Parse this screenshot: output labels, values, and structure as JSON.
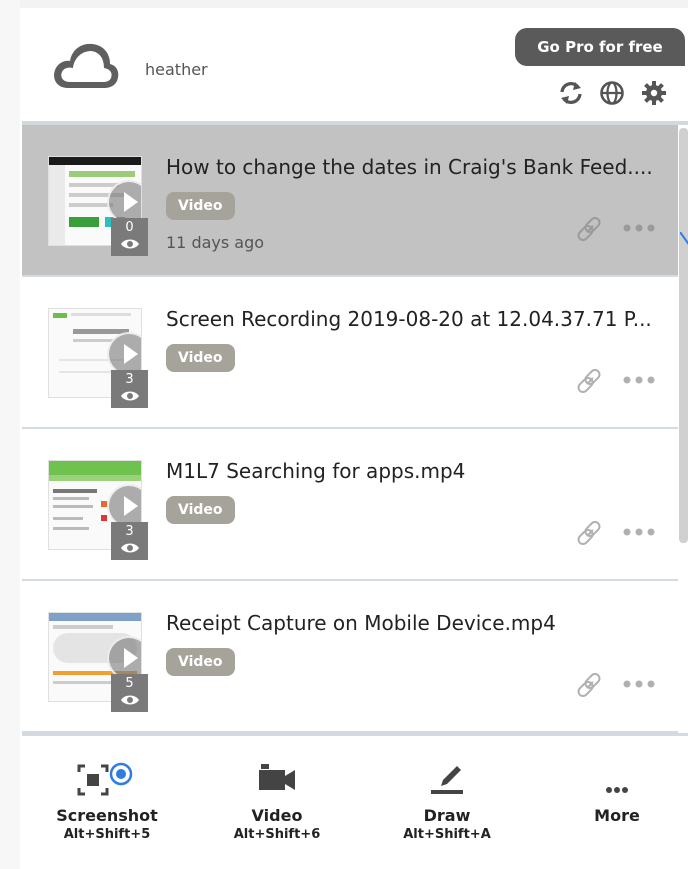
{
  "header": {
    "username": "heather",
    "gopro_label": "Go Pro for free"
  },
  "items": [
    {
      "title": "How to change the dates in Craig's Bank Feed....",
      "badge": "Video",
      "views": "0",
      "date": "11 days ago",
      "selected": true
    },
    {
      "title": "Screen Recording 2019-08-20 at 12.04.37.71 P...",
      "badge": "Video",
      "views": "3",
      "date": ""
    },
    {
      "title": "M1L7 Searching for apps.mp4",
      "badge": "Video",
      "views": "3",
      "date": ""
    },
    {
      "title": "Receipt Capture on Mobile Device.mp4",
      "badge": "Video",
      "views": "5",
      "date": ""
    }
  ],
  "toolbar": {
    "screenshot_label": "Screenshot",
    "screenshot_shortcut": "Alt+Shift+5",
    "video_label": "Video",
    "video_shortcut": "Alt+Shift+6",
    "draw_label": "Draw",
    "draw_shortcut": "Alt+Shift+A",
    "more_label": "More"
  },
  "colors": {
    "selected_row": "#c2c2c2",
    "badge": "#a6a39a",
    "gopro_bg": "#5a5a5a",
    "accent_blue": "#2f7de1"
  }
}
